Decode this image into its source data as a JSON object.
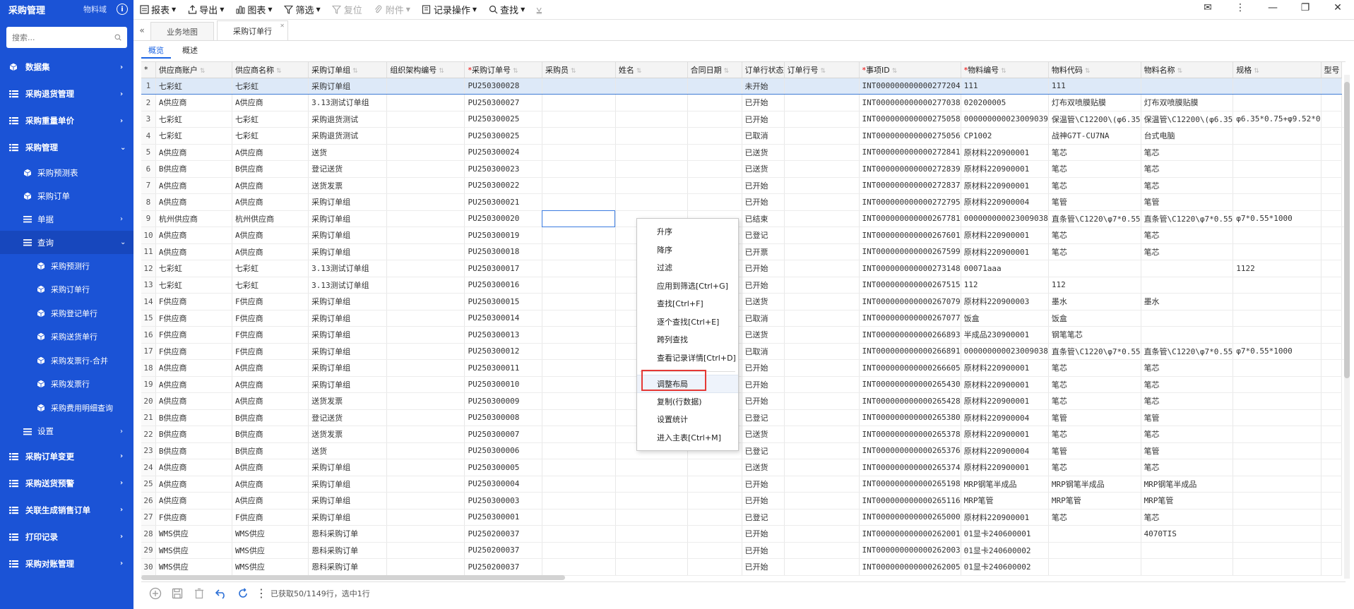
{
  "sidebar": {
    "title": "采购管理",
    "domain": "物料域",
    "info_icon": "info-circle-icon",
    "search_placeholder": "搜索...",
    "items": [
      {
        "label": "数据集",
        "level": 1,
        "icon": "cube-icon",
        "chevron": "›"
      },
      {
        "label": "采购退货管理",
        "level": 1,
        "icon": "list-icon",
        "chevron": "›"
      },
      {
        "label": "采购重量单价",
        "level": 1,
        "icon": "list-icon",
        "chevron": "›"
      },
      {
        "label": "采购管理",
        "level": 1,
        "icon": "list-icon",
        "chevron": "⌄"
      },
      {
        "label": "采购预测表",
        "level": 2,
        "icon": "cube-icon",
        "chevron": ""
      },
      {
        "label": "采购订单",
        "level": 2,
        "icon": "cube-icon",
        "chevron": ""
      },
      {
        "label": "单据",
        "level": 2,
        "icon": "menu-icon",
        "chevron": "›"
      },
      {
        "label": "查询",
        "level": 2,
        "icon": "menu-icon",
        "chevron": "⌄"
      },
      {
        "label": "采购预测行",
        "level": 3,
        "icon": "cube-icon",
        "chevron": ""
      },
      {
        "label": "采购订单行",
        "level": 3,
        "icon": "cube-icon",
        "chevron": ""
      },
      {
        "label": "采购登记单行",
        "level": 3,
        "icon": "cube-icon",
        "chevron": ""
      },
      {
        "label": "采购送货单行",
        "level": 3,
        "icon": "cube-icon",
        "chevron": ""
      },
      {
        "label": "采购发票行-合并",
        "level": 3,
        "icon": "cube-icon",
        "chevron": ""
      },
      {
        "label": "采购发票行",
        "level": 3,
        "icon": "cube-icon",
        "chevron": ""
      },
      {
        "label": "采购费用明细查询",
        "level": 3,
        "icon": "cube-icon",
        "chevron": ""
      },
      {
        "label": "设置",
        "level": 2,
        "icon": "menu-icon",
        "chevron": "›"
      },
      {
        "label": "采购订单变更",
        "level": 1,
        "icon": "list-icon",
        "chevron": "›"
      },
      {
        "label": "采购送货预警",
        "level": 1,
        "icon": "list-icon",
        "chevron": "›"
      },
      {
        "label": "关联生成销售订单",
        "level": 1,
        "icon": "list-icon",
        "chevron": "›"
      },
      {
        "label": "打印记录",
        "level": 1,
        "icon": "list-icon",
        "chevron": "›"
      },
      {
        "label": "采购对账管理",
        "level": 1,
        "icon": "list-icon",
        "chevron": "›"
      }
    ]
  },
  "toolbar": {
    "items": [
      {
        "label": "报表",
        "icon": "report-icon",
        "caret": true,
        "disabled": false
      },
      {
        "label": "导出",
        "icon": "export-icon",
        "caret": true,
        "disabled": false
      },
      {
        "label": "图表",
        "icon": "chart-icon",
        "caret": true,
        "disabled": false
      },
      {
        "label": "筛选",
        "icon": "filter-icon",
        "caret": true,
        "disabled": false
      },
      {
        "label": "复位",
        "icon": "filter-reset-icon",
        "caret": false,
        "disabled": true
      },
      {
        "label": "附件",
        "icon": "paperclip-icon",
        "caret": true,
        "disabled": true
      },
      {
        "label": "记录操作",
        "icon": "record-icon",
        "caret": true,
        "disabled": false
      },
      {
        "label": "查找",
        "icon": "search-icon",
        "caret": true,
        "disabled": false
      }
    ]
  },
  "tabs": [
    {
      "label": "业务地图",
      "active": false
    },
    {
      "label": "采购订单行",
      "active": true
    }
  ],
  "subtabs": [
    {
      "label": "概览",
      "active": true
    },
    {
      "label": "概述",
      "active": false
    }
  ],
  "grid": {
    "columns": [
      {
        "label": "*",
        "width": 22,
        "required": false,
        "sort": false
      },
      {
        "label": "供应商账户",
        "width": 117,
        "required": false,
        "sort": true
      },
      {
        "label": "供应商名称",
        "width": 117,
        "required": false,
        "sort": true
      },
      {
        "label": "采购订单组",
        "width": 117,
        "required": false,
        "sort": true
      },
      {
        "label": "组织架构编号",
        "width": 117,
        "required": false,
        "sort": true
      },
      {
        "label": "采购订单号",
        "width": 117,
        "required": true,
        "sort": true
      },
      {
        "label": "采购员",
        "width": 117,
        "required": false,
        "sort": true
      },
      {
        "label": "姓名",
        "width": 117,
        "required": false,
        "sort": true
      },
      {
        "label": "合同日期",
        "width": 81,
        "required": false,
        "sort": true
      },
      {
        "label": "订单行状态",
        "width": 59,
        "required": false,
        "sort": false
      },
      {
        "label": "订单行号",
        "width": 117,
        "required": false,
        "sort": true
      },
      {
        "label": "事项ID",
        "width": 117,
        "required": true,
        "sort": true
      },
      {
        "label": "物料编号",
        "width": 117,
        "required": true,
        "sort": true
      },
      {
        "label": "物料代码",
        "width": 117,
        "required": false,
        "sort": true
      },
      {
        "label": "物料名称",
        "width": 117,
        "required": false,
        "sort": true
      },
      {
        "label": "规格",
        "width": 117,
        "required": false,
        "sort": true
      },
      {
        "label": "型号",
        "width": 30,
        "required": false,
        "sort": false
      }
    ],
    "rows": [
      [
        "1",
        "七彩虹",
        "七彩虹",
        "采购订单组",
        "",
        "PU250300028",
        "",
        "",
        "",
        "未开始",
        "",
        "INT000000000000277204",
        "111",
        "111",
        "",
        "",
        ""
      ],
      [
        "2",
        "A供应商",
        "A供应商",
        "3.13测试订单组",
        "",
        "PU250300027",
        "",
        "",
        "",
        "已开始",
        "",
        "INT000000000000277038",
        "020200005",
        "灯布双喷膜贴膜",
        "灯布双喷膜贴膜",
        "",
        ""
      ],
      [
        "3",
        "七彩虹",
        "七彩虹",
        "采购退货测试",
        "",
        "PU250300025",
        "",
        "",
        "",
        "已开始",
        "",
        "INT000000000000275058",
        "000000000023009039",
        "保温管\\C12200\\(φ6.35",
        "保温管\\C12200\\(φ6.35",
        "φ6.35*0.75+φ9.52*0",
        "",
        ""
      ],
      [
        "4",
        "七彩虹",
        "七彩虹",
        "采购退货测试",
        "",
        "PU250300025",
        "",
        "",
        "",
        "已取消",
        "",
        "INT000000000000275056",
        "CP1002",
        "战神G7T-CU7NA",
        "台式电脑",
        "",
        ""
      ],
      [
        "5",
        "A供应商",
        "A供应商",
        "送货",
        "",
        "PU250300024",
        "",
        "",
        "",
        "已送货",
        "",
        "INT000000000000272841",
        "原材料220900001",
        "笔芯",
        "笔芯",
        "",
        ""
      ],
      [
        "6",
        "B供应商",
        "B供应商",
        "登记送货",
        "",
        "PU250300023",
        "",
        "",
        "",
        "已送货",
        "",
        "INT000000000000272839",
        "原材料220900001",
        "笔芯",
        "笔芯",
        "",
        ""
      ],
      [
        "7",
        "A供应商",
        "A供应商",
        "送货发票",
        "",
        "PU250300022",
        "",
        "",
        "",
        "已开始",
        "",
        "INT000000000000272837",
        "原材料220900001",
        "笔芯",
        "笔芯",
        "",
        ""
      ],
      [
        "8",
        "A供应商",
        "A供应商",
        "采购订单组",
        "",
        "PU250300021",
        "",
        "",
        "",
        "已开始",
        "",
        "INT000000000000272795",
        "原材料220900004",
        "笔管",
        "笔管",
        "",
        ""
      ],
      [
        "9",
        "杭州供应商",
        "杭州供应商",
        "采购订单组",
        "",
        "PU250300020",
        "",
        "",
        "",
        "已结束",
        "",
        "INT000000000000267781",
        "000000000023009038",
        "直条管\\C1220\\φ7*0.55",
        "直条管\\C1220\\φ7*0.55",
        "φ7*0.55*1000",
        "",
        ""
      ],
      [
        "10",
        "A供应商",
        "A供应商",
        "采购订单组",
        "",
        "PU250300019",
        "",
        "",
        "",
        "已登记",
        "",
        "INT000000000000267601",
        "原材料220900001",
        "笔芯",
        "笔芯",
        "",
        ""
      ],
      [
        "11",
        "A供应商",
        "A供应商",
        "采购订单组",
        "",
        "PU250300018",
        "",
        "",
        "",
        "已开票",
        "",
        "INT000000000000267599",
        "原材料220900001",
        "笔芯",
        "笔芯",
        "",
        ""
      ],
      [
        "12",
        "七彩虹",
        "七彩虹",
        "3.13测试订单组",
        "",
        "PU250300017",
        "",
        "",
        "",
        "已开始",
        "",
        "INT000000000000273148",
        "00071aaa",
        "",
        "",
        "1122",
        ""
      ],
      [
        "13",
        "七彩虹",
        "七彩虹",
        "3.13测试订单组",
        "",
        "PU250300016",
        "",
        "",
        "",
        "已开始",
        "",
        "INT000000000000267515",
        "112",
        "112",
        "",
        "",
        ""
      ],
      [
        "14",
        "F供应商",
        "F供应商",
        "采购订单组",
        "",
        "PU250300015",
        "",
        "",
        "",
        "已送货",
        "",
        "INT000000000000267079",
        "原材料220900003",
        "墨水",
        "墨水",
        "",
        ""
      ],
      [
        "15",
        "F供应商",
        "F供应商",
        "采购订单组",
        "",
        "PU250300014",
        "",
        "",
        "",
        "已取消",
        "",
        "INT000000000000267077",
        "饭盒",
        "饭盒",
        "",
        "",
        ""
      ],
      [
        "16",
        "F供应商",
        "F供应商",
        "采购订单组",
        "",
        "PU250300013",
        "",
        "",
        "",
        "已送货",
        "",
        "INT000000000000266893",
        "半成品230900001",
        "钢笔笔芯",
        "",
        "",
        ""
      ],
      [
        "17",
        "F供应商",
        "F供应商",
        "采购订单组",
        "",
        "PU250300012",
        "",
        "",
        "",
        "已取消",
        "",
        "INT000000000000266891",
        "000000000023009038",
        "直条管\\C1220\\φ7*0.55",
        "直条管\\C1220\\φ7*0.55",
        "φ7*0.55*1000",
        "",
        ""
      ],
      [
        "18",
        "A供应商",
        "A供应商",
        "采购订单组",
        "",
        "PU250300011",
        "",
        "",
        "",
        "已开始",
        "",
        "INT000000000000266605",
        "原材料220900001",
        "笔芯",
        "笔芯",
        "",
        ""
      ],
      [
        "19",
        "A供应商",
        "A供应商",
        "采购订单组",
        "",
        "PU250300010",
        "",
        "",
        "",
        "已开始",
        "",
        "INT000000000000265430",
        "原材料220900001",
        "笔芯",
        "笔芯",
        "",
        ""
      ],
      [
        "20",
        "A供应商",
        "A供应商",
        "送货发票",
        "",
        "PU250300009",
        "",
        "",
        "",
        "已开始",
        "",
        "INT000000000000265428",
        "原材料220900001",
        "笔芯",
        "笔芯",
        "",
        ""
      ],
      [
        "21",
        "B供应商",
        "B供应商",
        "登记送货",
        "",
        "PU250300008",
        "",
        "",
        "",
        "已登记",
        "",
        "INT000000000000265380",
        "原材料220900004",
        "笔管",
        "笔管",
        "",
        ""
      ],
      [
        "22",
        "B供应商",
        "B供应商",
        "送货发票",
        "",
        "PU250300007",
        "",
        "",
        "",
        "已送货",
        "",
        "INT000000000000265378",
        "原材料220900001",
        "笔芯",
        "笔芯",
        "",
        ""
      ],
      [
        "23",
        "B供应商",
        "B供应商",
        "送货",
        "",
        "PU250300006",
        "",
        "",
        "",
        "已登记",
        "",
        "INT000000000000265376",
        "原材料220900004",
        "笔管",
        "笔管",
        "",
        ""
      ],
      [
        "24",
        "A供应商",
        "A供应商",
        "采购订单组",
        "",
        "PU250300005",
        "",
        "",
        "",
        "已送货",
        "",
        "INT000000000000265374",
        "原材料220900001",
        "笔芯",
        "笔芯",
        "",
        ""
      ],
      [
        "25",
        "A供应商",
        "A供应商",
        "采购订单组",
        "",
        "PU250300004",
        "",
        "",
        "",
        "已开始",
        "",
        "INT000000000000265198",
        "MRP钢笔半成品",
        "MRP钢笔半成品",
        "MRP钢笔半成品",
        "",
        ""
      ],
      [
        "26",
        "A供应商",
        "A供应商",
        "采购订单组",
        "",
        "PU250300003",
        "",
        "",
        "",
        "已开始",
        "",
        "INT000000000000265116",
        "MRP笔管",
        "MRP笔管",
        "MRP笔管",
        "",
        ""
      ],
      [
        "27",
        "F供应商",
        "F供应商",
        "采购订单组",
        "",
        "PU250300001",
        "",
        "",
        "",
        "已登记",
        "",
        "INT000000000000265000",
        "原材料220900001",
        "笔芯",
        "笔芯",
        "",
        ""
      ],
      [
        "28",
        "WMS供应",
        "WMS供应",
        "恩科采购订单",
        "",
        "PU250200037",
        "",
        "",
        "",
        "已开始",
        "",
        "INT000000000000262001",
        "01显卡240600001",
        "",
        "4070TIS",
        "",
        ""
      ],
      [
        "29",
        "WMS供应",
        "WMS供应",
        "恩科采购订单",
        "",
        "PU250200037",
        "",
        "",
        "",
        "已开始",
        "",
        "INT000000000000262003",
        "01显卡240600002",
        "",
        "",
        "",
        ""
      ],
      [
        "30",
        "WMS供应",
        "WMS供应",
        "恩科采购订单",
        "",
        "PU250200037",
        "",
        "",
        "",
        "已开始",
        "",
        "INT000000000000262005",
        "01显卡240600002",
        "",
        "",
        "",
        ""
      ]
    ]
  },
  "context_menu": {
    "items": [
      "升序",
      "降序",
      "过滤",
      "应用到筛选[Ctrl+G]",
      "查找[Ctrl+F]",
      "逐个查找[Ctrl+E]",
      "跨列查找",
      "查看记录详情[Ctrl+D]"
    ],
    "items2": [
      "调整布局",
      "复制(行数据)",
      "设置统计",
      "进入主表[Ctrl+M]"
    ]
  },
  "bottombar": {
    "status": "已获取50/1149行，选中1行",
    "icons": [
      "add-circle-icon",
      "save-icon",
      "delete-icon",
      "undo-icon",
      "refresh-icon",
      "more-vertical-icon"
    ]
  }
}
